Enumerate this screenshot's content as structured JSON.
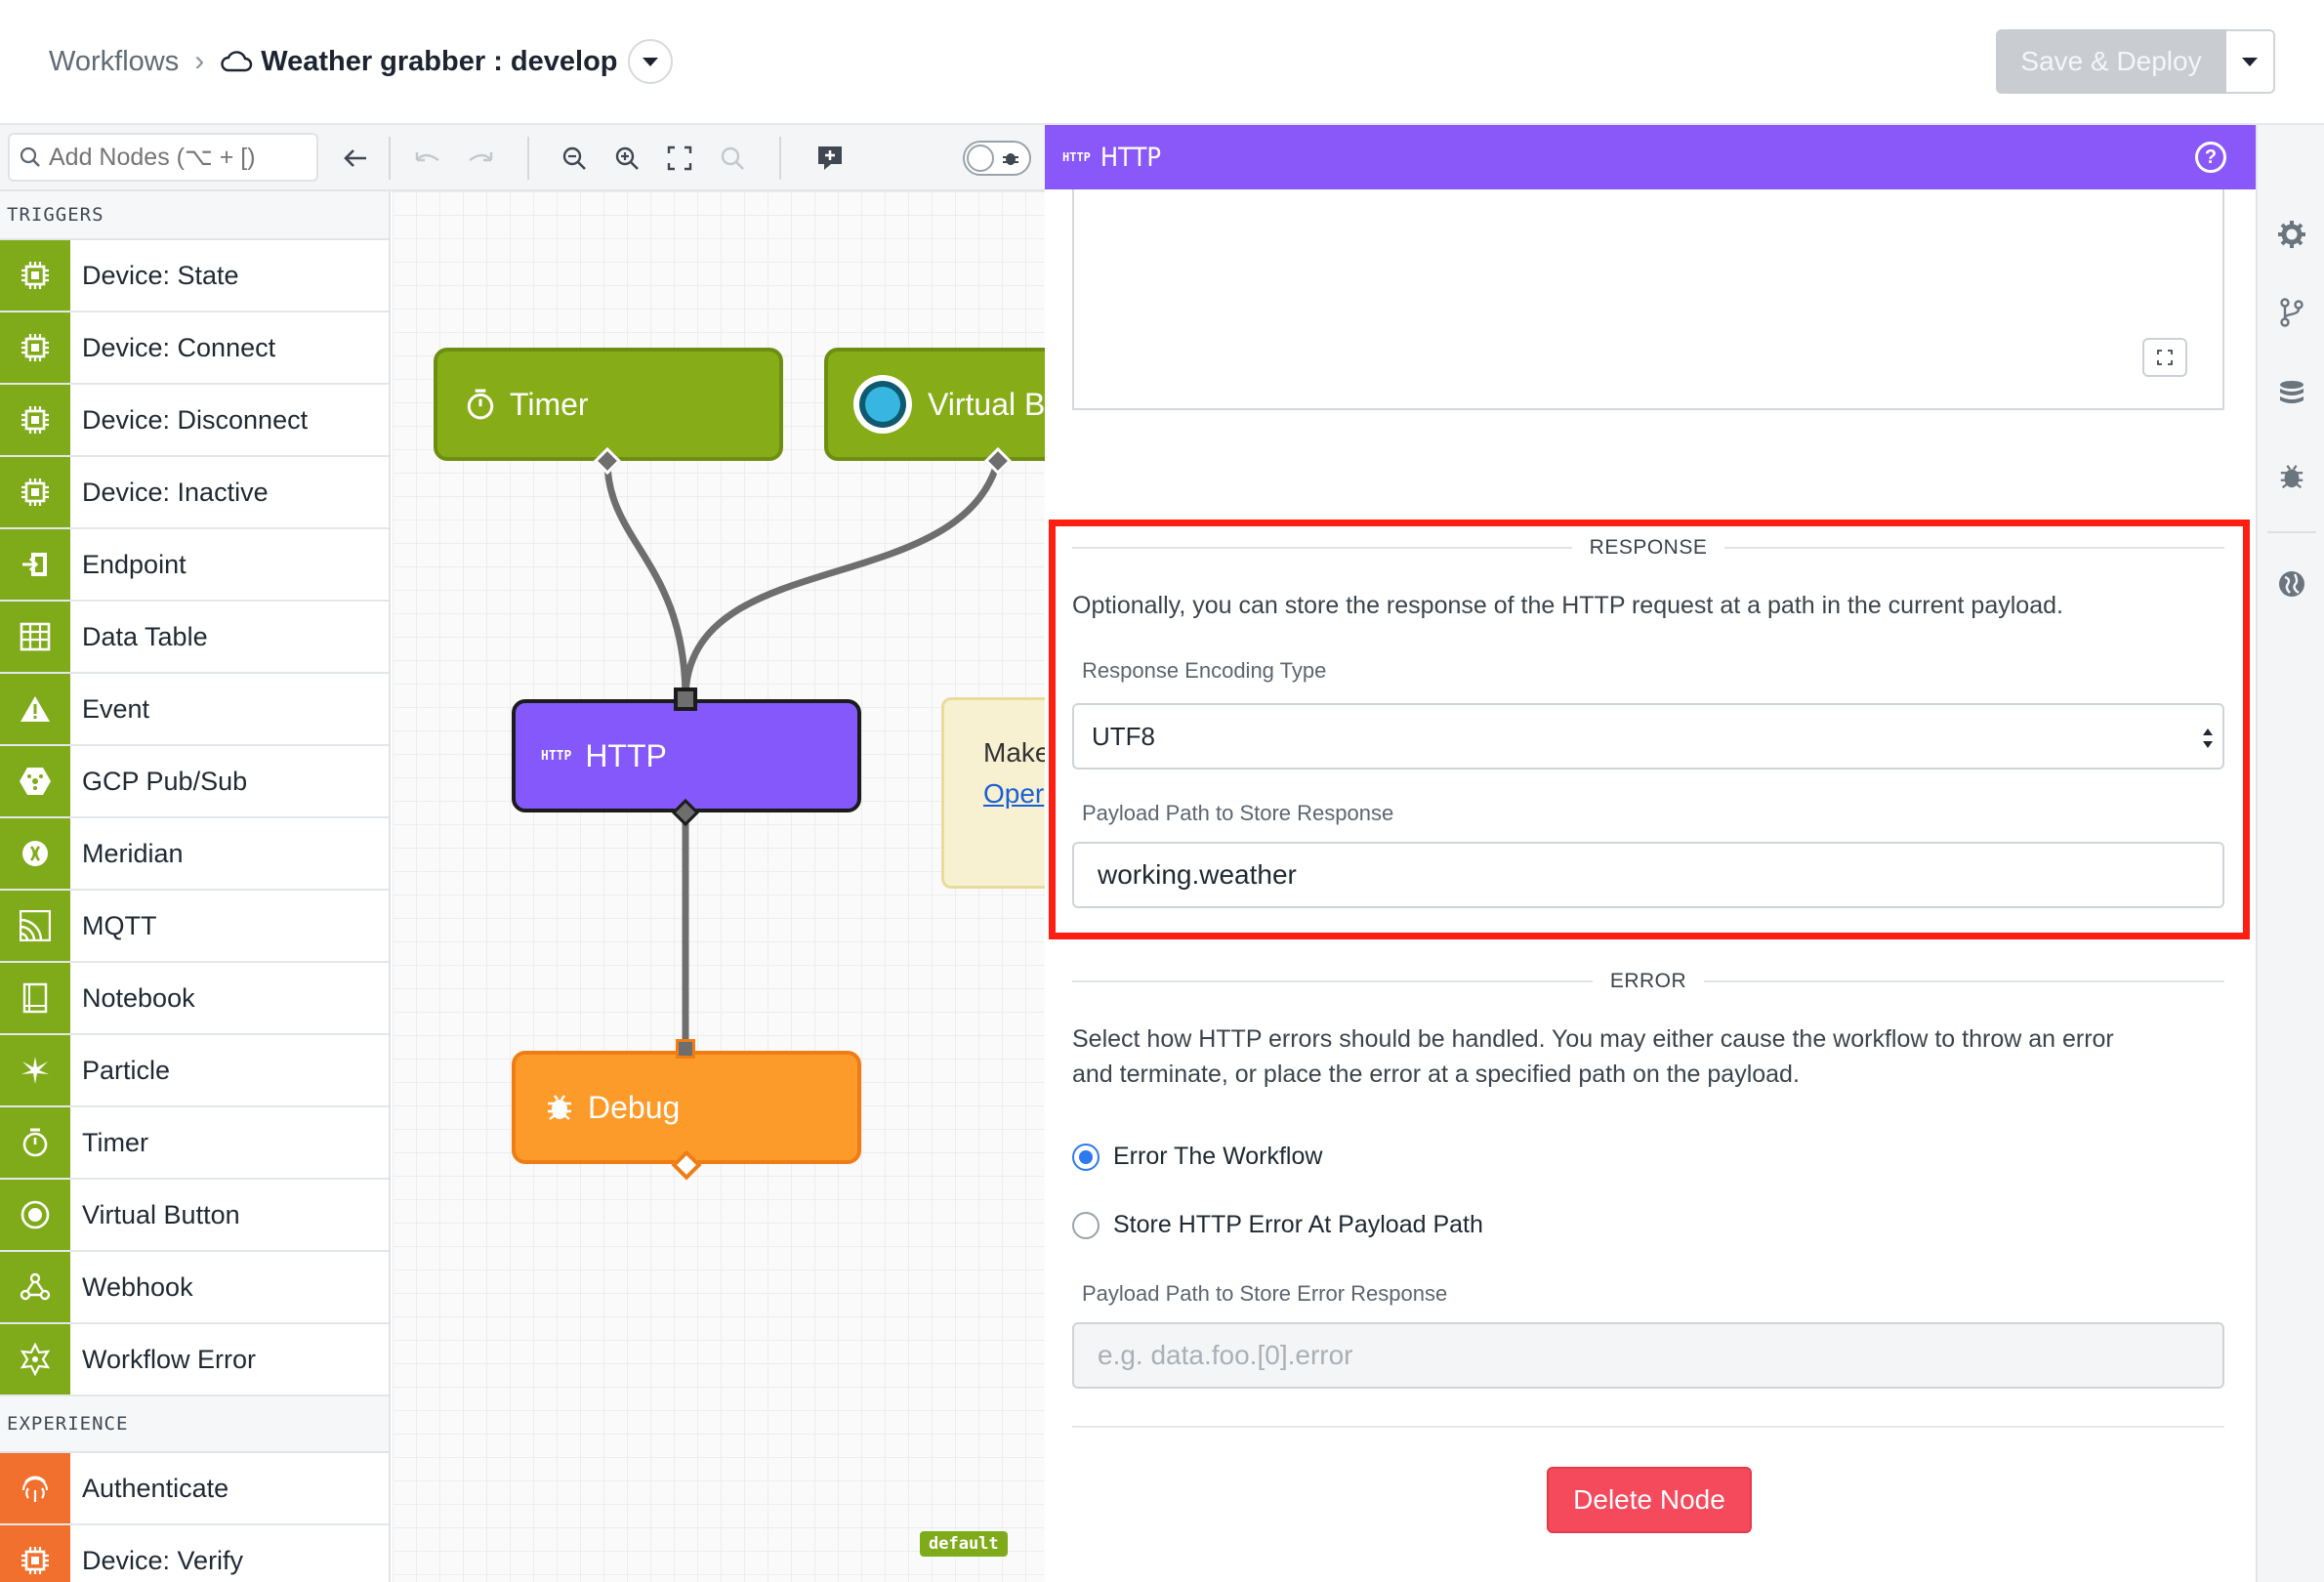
{
  "breadcrumb": {
    "root": "Workflows",
    "separator": "›",
    "title": "Weather grabber : develop"
  },
  "header": {
    "deploy_label": "Save & Deploy"
  },
  "toolbar": {
    "search_placeholder": "Add Nodes (⌥ + [)"
  },
  "sidebar": {
    "triggers_title": "TRIGGERS",
    "triggers": [
      {
        "label": "Device: State",
        "icon": "chip-icon"
      },
      {
        "label": "Device: Connect",
        "icon": "chip-icon"
      },
      {
        "label": "Device: Disconnect",
        "icon": "chip-icon"
      },
      {
        "label": "Device: Inactive",
        "icon": "chip-icon"
      },
      {
        "label": "Endpoint",
        "icon": "endpoint-icon"
      },
      {
        "label": "Data Table",
        "icon": "table-icon"
      },
      {
        "label": "Event",
        "icon": "warning-icon"
      },
      {
        "label": "GCP Pub/Sub",
        "icon": "gcp-icon"
      },
      {
        "label": "Meridian",
        "icon": "meridian-icon"
      },
      {
        "label": "MQTT",
        "icon": "mqtt-icon"
      },
      {
        "label": "Notebook",
        "icon": "notebook-icon"
      },
      {
        "label": "Particle",
        "icon": "particle-icon"
      },
      {
        "label": "Timer",
        "icon": "timer-icon"
      },
      {
        "label": "Virtual Button",
        "icon": "virtual-button-icon"
      },
      {
        "label": "Webhook",
        "icon": "webhook-icon"
      },
      {
        "label": "Workflow Error",
        "icon": "workflow-error-icon"
      }
    ],
    "experience_title": "EXPERIENCE",
    "experience": [
      {
        "label": "Authenticate",
        "icon": "fingerprint-icon"
      },
      {
        "label": "Device: Verify",
        "icon": "chip-icon"
      }
    ]
  },
  "canvas": {
    "nodes": {
      "timer": "Timer",
      "virtual": "Virtual B",
      "http": "HTTP",
      "http_tag": "HTTP",
      "debug": "Debug"
    },
    "note": {
      "text": "Make",
      "link": "Oper"
    },
    "badge": "default"
  },
  "panel": {
    "tag": "HTTP",
    "title": "HTTP",
    "response": {
      "heading": "RESPONSE",
      "description": "Optionally, you can store the response of the HTTP request at a path in the current payload.",
      "encoding_label": "Response Encoding Type",
      "encoding_value": "UTF8",
      "path_label": "Payload Path to Store Response",
      "path_value": "working.weather"
    },
    "error": {
      "heading": "ERROR",
      "description_line1": "Select how HTTP errors should be handled. You may either cause the workflow to throw an error",
      "description_line2": "and terminate, or place the error at a specified path on the payload.",
      "option1": "Error The Workflow",
      "option2": "Store HTTP Error At Payload Path",
      "path_label": "Payload Path to Store Error Response",
      "path_placeholder": "e.g. data.foo.[0].error"
    },
    "delete_label": "Delete Node"
  },
  "colors": {
    "trigger_green": "#7fab1b",
    "experience_orange": "#f2702e",
    "http_purple": "#8a58f8",
    "debug_orange": "#fb9a2b",
    "highlight_red": "#ff1f12",
    "delete_red": "#f5495c"
  }
}
